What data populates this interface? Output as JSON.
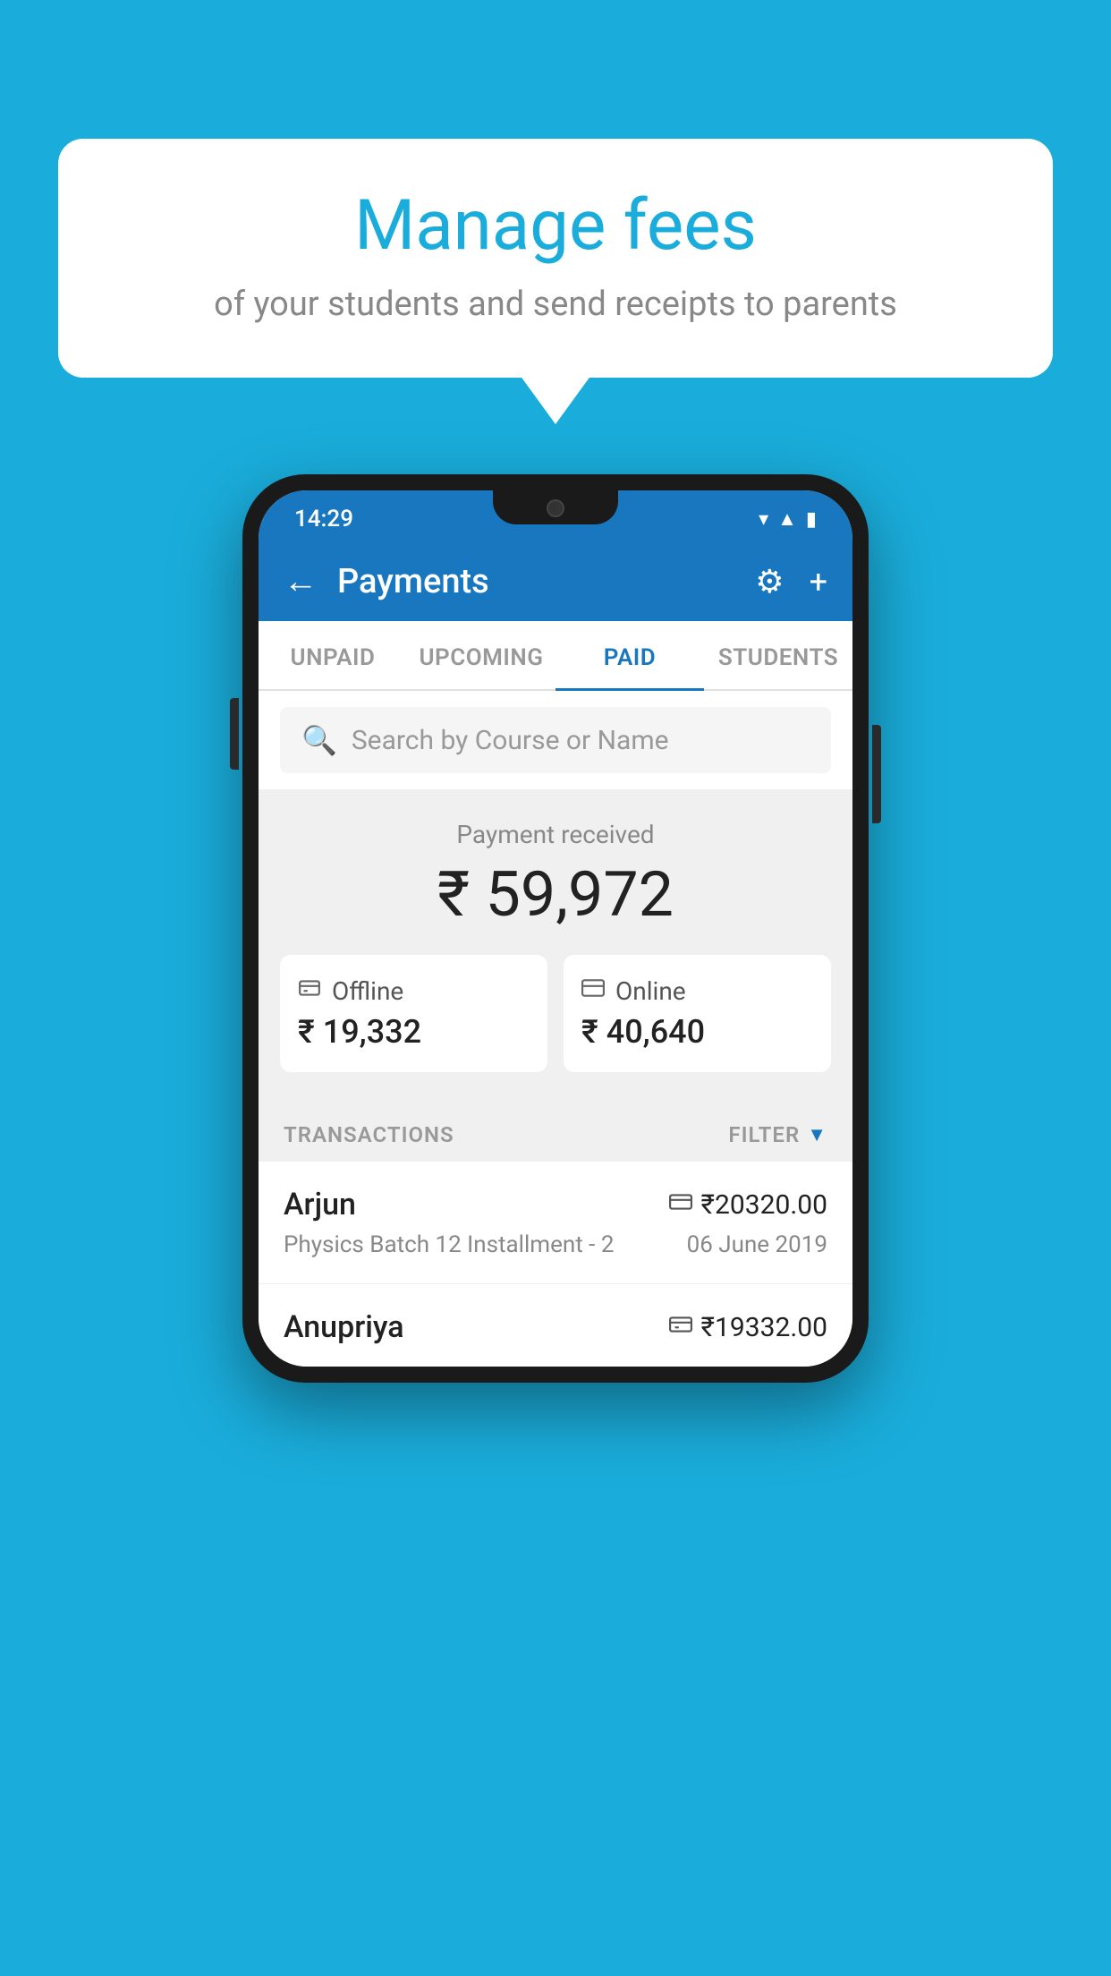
{
  "background_color": "#1AADDB",
  "speech_bubble": {
    "title": "Manage fees",
    "subtitle": "of your students and send receipts to parents"
  },
  "phone": {
    "status_bar": {
      "time": "14:29",
      "icons": [
        "wifi",
        "signal",
        "battery"
      ]
    },
    "app_bar": {
      "title": "Payments",
      "back_label": "←",
      "gear_label": "⚙",
      "plus_label": "+"
    },
    "tabs": [
      {
        "label": "UNPAID",
        "active": false
      },
      {
        "label": "UPCOMING",
        "active": false
      },
      {
        "label": "PAID",
        "active": true
      },
      {
        "label": "STUDENTS",
        "active": false
      }
    ],
    "search": {
      "placeholder": "Search by Course or Name"
    },
    "payment_received": {
      "label": "Payment received",
      "amount": "₹ 59,972",
      "offline": {
        "label": "Offline",
        "amount": "₹ 19,332"
      },
      "online": {
        "label": "Online",
        "amount": "₹ 40,640"
      }
    },
    "transactions": {
      "header_label": "TRANSACTIONS",
      "filter_label": "FILTER",
      "rows": [
        {
          "name": "Arjun",
          "course": "Physics Batch 12 Installment - 2",
          "amount": "₹20320.00",
          "date": "06 June 2019",
          "icon": "card"
        },
        {
          "name": "Anupriya",
          "course": "",
          "amount": "₹19332.00",
          "date": "",
          "icon": "cash"
        }
      ]
    }
  }
}
